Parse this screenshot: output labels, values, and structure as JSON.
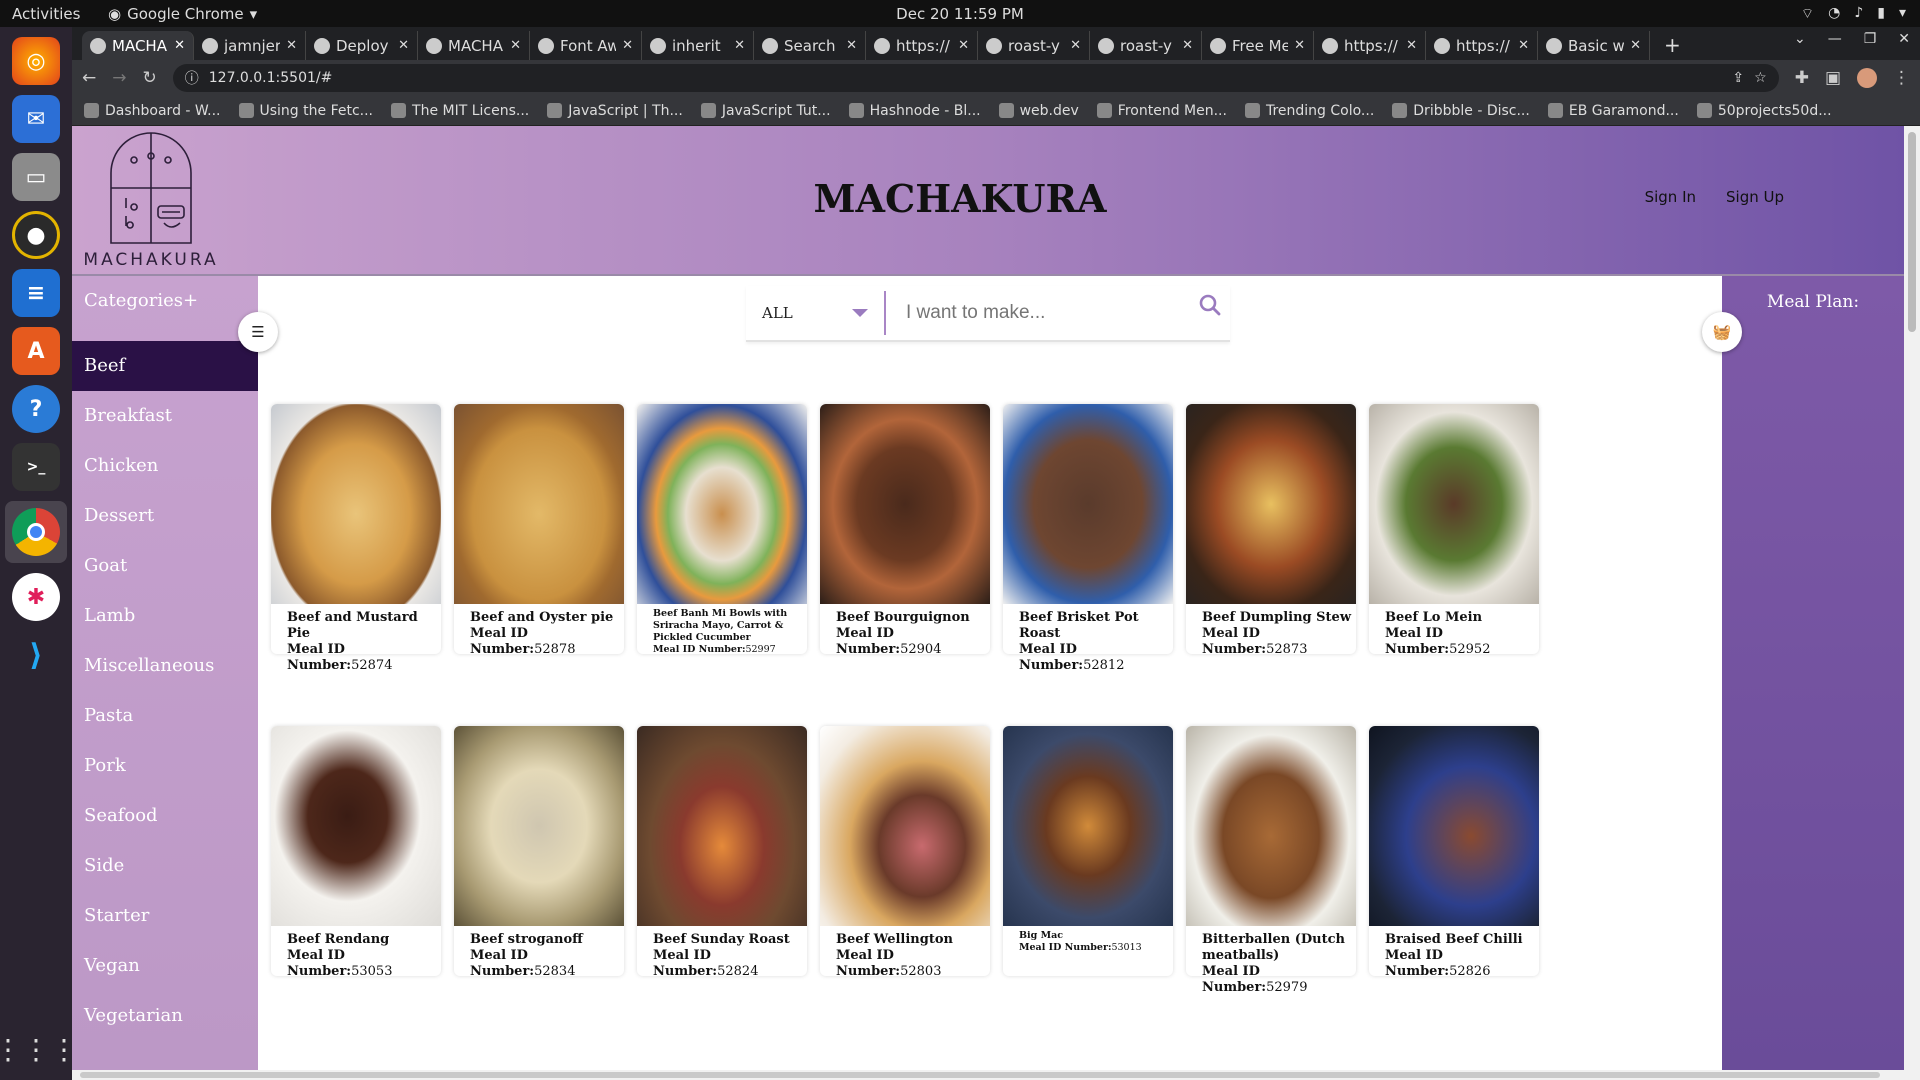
{
  "os": {
    "activities": "Activities",
    "app_name": "Google Chrome",
    "clock": "Dec 20  11:59 PM"
  },
  "browser": {
    "tabs": [
      {
        "title": "MACHA"
      },
      {
        "title": "jamnjer"
      },
      {
        "title": "Deploy"
      },
      {
        "title": "MACHA"
      },
      {
        "title": "Font Aw"
      },
      {
        "title": "inherit"
      },
      {
        "title": "Search i"
      },
      {
        "title": "https://"
      },
      {
        "title": "roast-y"
      },
      {
        "title": "roast-y"
      },
      {
        "title": "Free Me"
      },
      {
        "title": "https://"
      },
      {
        "title": "https://"
      },
      {
        "title": "Basic w"
      }
    ],
    "url": "127.0.0.1:5501/#",
    "bookmarks": [
      "Dashboard - W...",
      "Using the Fetc...",
      "The MIT Licens...",
      "JavaScript | Th...",
      "JavaScript Tut...",
      "Hashnode - Bl...",
      "web.dev",
      "Frontend Men...",
      "Trending Colo...",
      "Dribbble - Disc...",
      "EB Garamond...",
      "50projects50d..."
    ]
  },
  "site": {
    "title": "MACHAKURA",
    "logo_text": "MACHAKURA",
    "sign_in": "Sign In",
    "sign_up": "Sign Up",
    "categories_heading": "Categories+",
    "categories": [
      "Beef",
      "Breakfast",
      "Chicken",
      "Dessert",
      "Goat",
      "Lamb",
      "Miscellaneous",
      "Pasta",
      "Pork",
      "Seafood",
      "Side",
      "Starter",
      "Vegan",
      "Vegetarian"
    ],
    "selected_category": "Beef",
    "search_filter": "ALL",
    "search_placeholder": "I want to make...",
    "meal_plan_title": "Meal Plan:",
    "meal_id_label": "Meal ID",
    "meal_number_label": "Number:",
    "meal_id_number_label": "Meal ID Number:",
    "meals": [
      {
        "name": "Beef and Mustard Pie",
        "id": "52874"
      },
      {
        "name": "Beef and Oyster pie",
        "id": "52878"
      },
      {
        "name": "Beef Banh Mi Bowls with Sriracha Mayo, Carrot & Pickled Cucumber",
        "id": "52997"
      },
      {
        "name": "Beef Bourguignon",
        "id": "52904"
      },
      {
        "name": "Beef Brisket Pot Roast",
        "id": "52812"
      },
      {
        "name": "Beef Dumpling Stew",
        "id": "52873"
      },
      {
        "name": "Beef Lo Mein",
        "id": "52952"
      },
      {
        "name": "Beef Rendang",
        "id": "53053"
      },
      {
        "name": "Beef stroganoff",
        "id": "52834"
      },
      {
        "name": "Beef Sunday Roast",
        "id": "52824"
      },
      {
        "name": "Beef Wellington",
        "id": "52803"
      },
      {
        "name": "Big Mac",
        "id": "53013"
      },
      {
        "name": "Bitterballen (Dutch meatballs)",
        "id": "52979"
      },
      {
        "name": "Braised Beef Chilli",
        "id": "52826"
      }
    ]
  },
  "colors": {
    "header_left": "#caa3ce",
    "header_right": "#6f53a6",
    "sidebar": "#c7a2cf",
    "selected_category": "#2a1146",
    "meal_plan_panel": "#7e5aa8",
    "accent": "#9a7bbf"
  }
}
